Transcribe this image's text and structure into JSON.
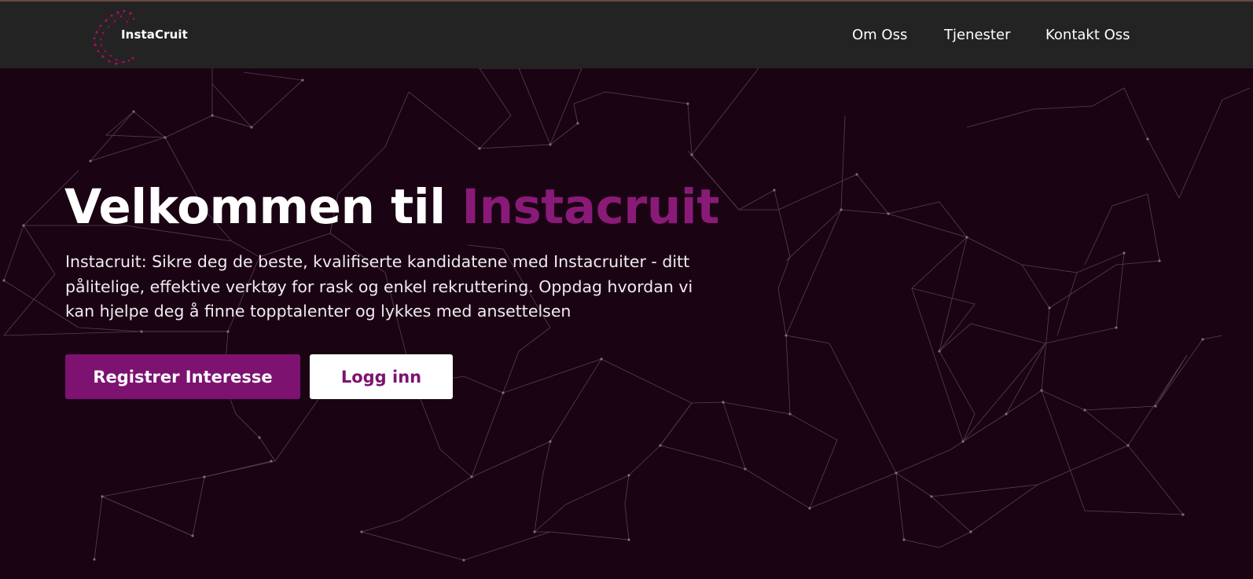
{
  "brand": {
    "name": "InstaCruit",
    "accent_color": "#8a1a78"
  },
  "nav": {
    "items": [
      {
        "label": "Om Oss"
      },
      {
        "label": "Tjenester"
      },
      {
        "label": "Kontakt Oss"
      }
    ]
  },
  "hero": {
    "title_prefix": "Velkommen til ",
    "title_accent": "Instacruit",
    "subtitle": "Instacruit: Sikre deg de beste, kvalifiserte kandidatene med Instacruiter - ditt pålitelige, effektive verktøy for rask og enkel rekruttering. Oppdag hvordan vi kan hjelpe deg å finne topptalenter og lykkes med ansettelsen",
    "primary_button": "Registrer Interesse",
    "secondary_button": "Logg inn"
  },
  "colors": {
    "header_bg": "#232323",
    "page_bg": "#1a0413",
    "button_primary": "#7d1270"
  }
}
